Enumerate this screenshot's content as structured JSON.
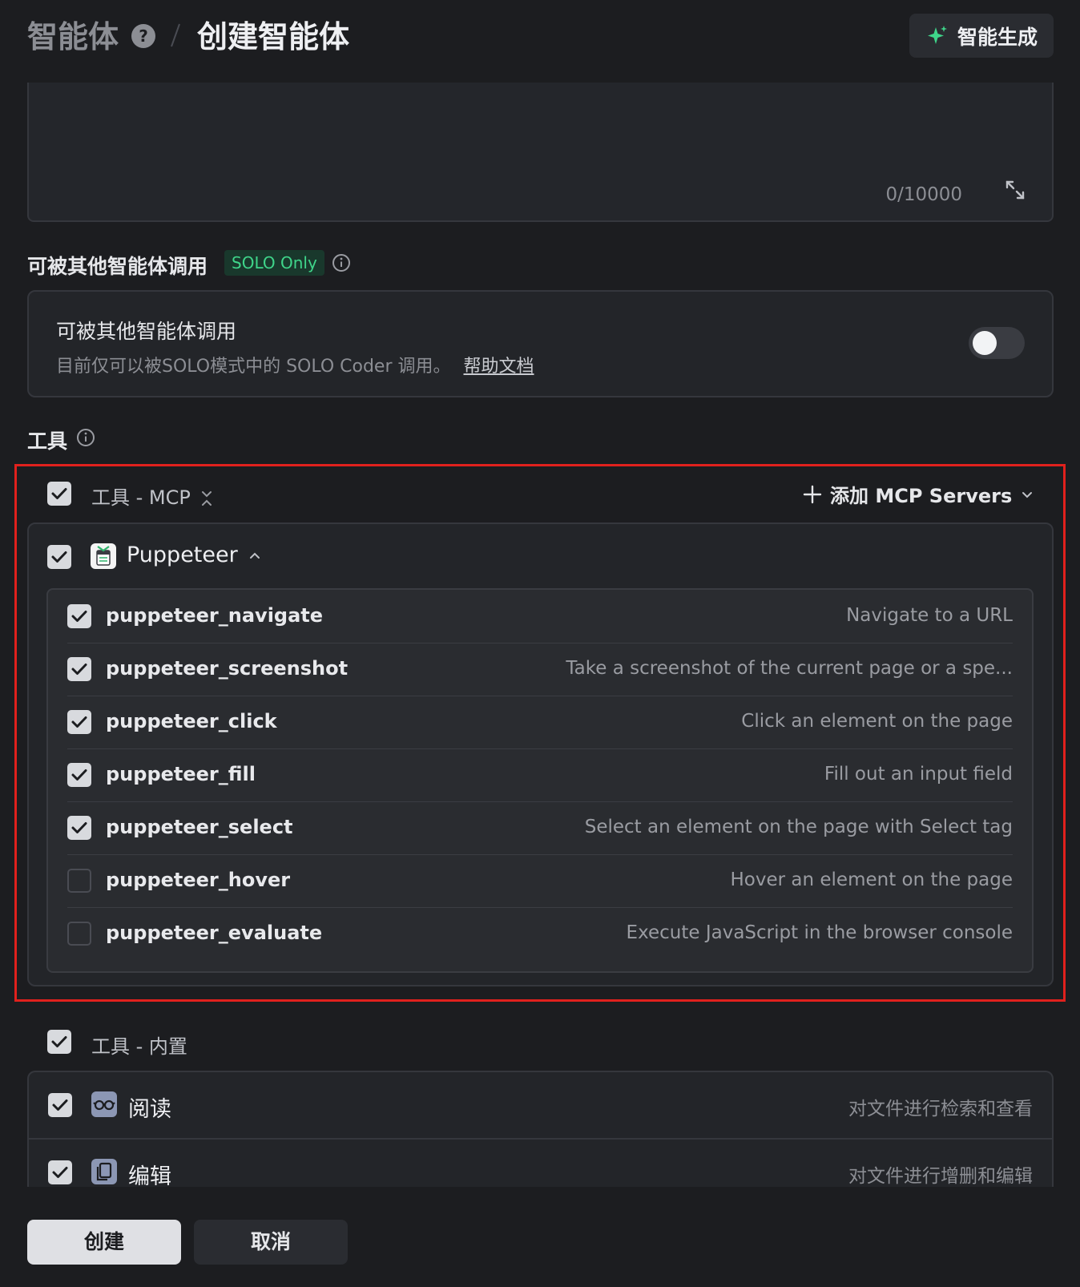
{
  "header": {
    "breadcrumb_root": "智能体",
    "breadcrumb_current": "创建智能体",
    "generate_label": "智能生成"
  },
  "prompt": {
    "counter": "0/10000"
  },
  "callable": {
    "section_title": "可被其他智能体调用",
    "badge": "SOLO Only",
    "title": "可被其他智能体调用",
    "description": "目前仅可以被SOLO模式中的 SOLO Coder 调用。",
    "help_link": "帮助文档",
    "enabled": false
  },
  "tools": {
    "section_title": "工具",
    "mcp": {
      "label": "工具 - MCP",
      "add_label": "添加 MCP Servers",
      "server": {
        "name": "Puppeteer",
        "items": [
          {
            "name": "puppeteer_navigate",
            "desc": "Navigate to a URL",
            "checked": true
          },
          {
            "name": "puppeteer_screenshot",
            "desc": "Take a screenshot of the current page or a spe...",
            "checked": true
          },
          {
            "name": "puppeteer_click",
            "desc": "Click an element on the page",
            "checked": true
          },
          {
            "name": "puppeteer_fill",
            "desc": "Fill out an input field",
            "checked": true
          },
          {
            "name": "puppeteer_select",
            "desc": "Select an element on the page with Select tag",
            "checked": true
          },
          {
            "name": "puppeteer_hover",
            "desc": "Hover an element on the page",
            "checked": false
          },
          {
            "name": "puppeteer_evaluate",
            "desc": "Execute JavaScript in the browser console",
            "checked": false
          }
        ]
      }
    },
    "builtin": {
      "label": "工具 - 内置",
      "items": [
        {
          "name": "阅读",
          "desc": "对文件进行检索和查看",
          "icon": "glasses-icon"
        },
        {
          "name": "编辑",
          "desc": "对文件进行增删和编辑",
          "icon": "copy-file-icon"
        }
      ]
    }
  },
  "footer": {
    "create_label": "创建",
    "cancel_label": "取消"
  },
  "colors": {
    "accent_green": "#3fd58a",
    "highlight_red": "#e0211d"
  }
}
